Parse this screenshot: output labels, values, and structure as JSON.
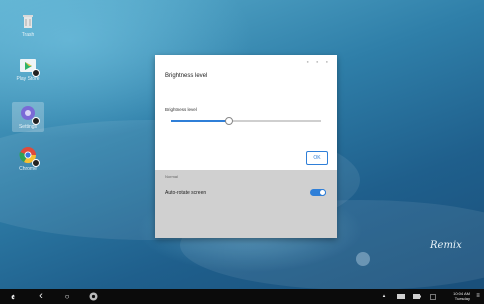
{
  "desktop": {
    "icons": [
      {
        "label": "Trash",
        "icon": "trash-icon"
      },
      {
        "label": "Play Store",
        "icon": "play-store-icon"
      },
      {
        "label": "Settings",
        "icon": "settings-icon"
      },
      {
        "label": "Chrome",
        "icon": "chrome-icon"
      }
    ],
    "brand": "Remix"
  },
  "dialog": {
    "title": "Brightness level",
    "slider_label": "Brightness level",
    "brightness_fraction": 0.38,
    "ok_label": "OK",
    "behind": {
      "normal_text": "Normal",
      "auto_rotate_label": "Auto-rotate screen",
      "auto_rotate_on": true
    }
  },
  "taskbar": {
    "logo": "ꬲ",
    "back_glyph": "‹",
    "home_glyph": "○",
    "time": "10:04 AM",
    "day": "Tuesday"
  },
  "colors": {
    "accent": "#2f7fd8",
    "taskbar": "#0b0b0b"
  }
}
